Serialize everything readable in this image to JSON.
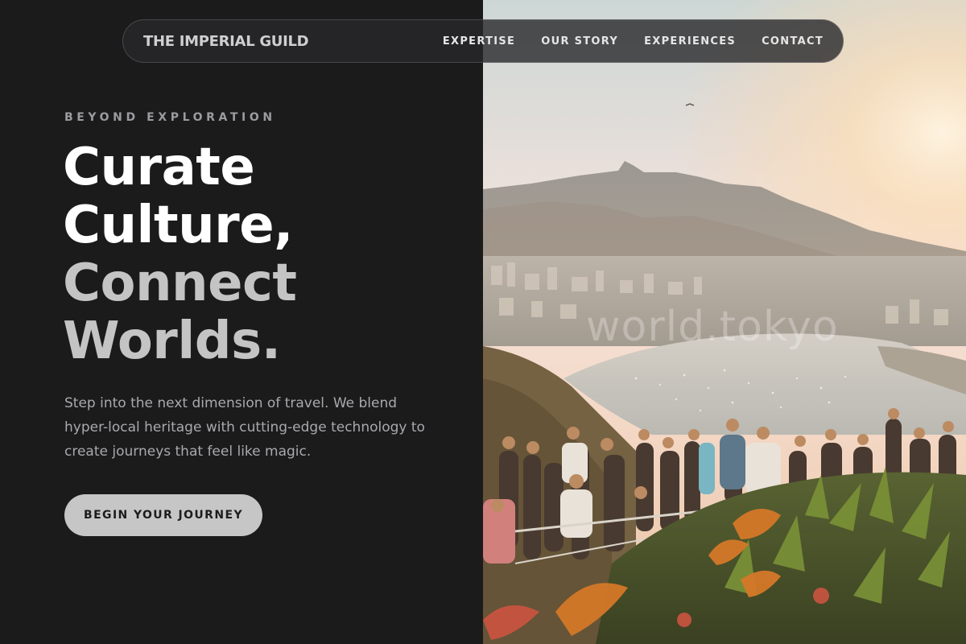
{
  "nav": {
    "brand": "THE IMPERIAL GUILD",
    "links": [
      {
        "label": "EXPERTISE"
      },
      {
        "label": "OUR STORY"
      },
      {
        "label": "EXPERIENCES"
      },
      {
        "label": "CONTACT"
      }
    ]
  },
  "hero": {
    "eyebrow": "BEYOND EXPLORATION",
    "headline_lines": [
      "Curate",
      "Culture,",
      "Connect",
      "Worlds."
    ],
    "description": "Step into the next dimension of travel. We blend hyper-local heritage with cutting-edge technology to create journeys that feel like magic.",
    "cta_label": "BEGIN YOUR JOURNEY",
    "image_watermark": "world.tokyo"
  },
  "colors": {
    "background": "#1b1b1c",
    "headline_primary": "#ffffff",
    "headline_secondary": "#c4c4c4",
    "body_text": "#a9a9ad",
    "cta_background": "#c6c6c6"
  }
}
